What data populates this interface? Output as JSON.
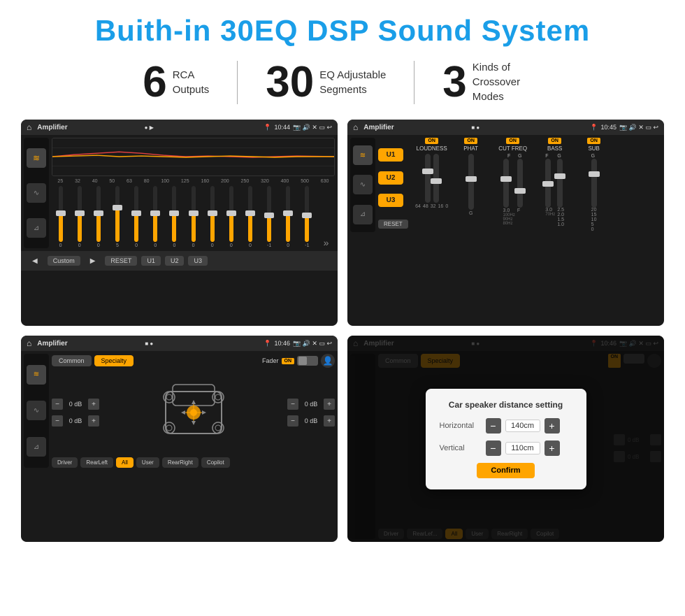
{
  "title": "Buith-in 30EQ DSP Sound System",
  "features": [
    {
      "number": "6",
      "line1": "RCA",
      "line2": "Outputs"
    },
    {
      "number": "30",
      "line1": "EQ Adjustable",
      "line2": "Segments"
    },
    {
      "number": "3",
      "line1": "Kinds of",
      "line2": "Crossover Modes"
    }
  ],
  "screens": {
    "eq": {
      "app_name": "Amplifier",
      "time": "10:44",
      "chart_labels": [
        "25",
        "32",
        "40",
        "50",
        "63",
        "80",
        "100",
        "125",
        "160",
        "200",
        "250",
        "320",
        "400",
        "500",
        "630"
      ],
      "slider_values": [
        "0",
        "0",
        "0",
        "5",
        "0",
        "0",
        "0",
        "0",
        "0",
        "0",
        "0",
        "-1",
        "0",
        "-1"
      ],
      "bottom_buttons": [
        "Custom",
        "RESET",
        "U1",
        "U2",
        "U3"
      ]
    },
    "crossover": {
      "app_name": "Amplifier",
      "time": "10:45",
      "presets": [
        "U1",
        "U2",
        "U3"
      ],
      "controls": [
        {
          "on": true,
          "label": "LOUDNESS",
          "value": ""
        },
        {
          "on": true,
          "label": "PHAT",
          "value": ""
        },
        {
          "on": true,
          "label": "CUT FREQ",
          "value": ""
        },
        {
          "on": true,
          "label": "BASS",
          "value": ""
        },
        {
          "on": true,
          "label": "SUB",
          "value": ""
        }
      ],
      "reset_label": "RESET"
    },
    "fader": {
      "app_name": "Amplifier",
      "time": "10:46",
      "tabs": [
        "Common",
        "Specialty"
      ],
      "fader_label": "Fader",
      "on_badge": "ON",
      "speaker_left_top": "0 dB",
      "speaker_left_bottom": "0 dB",
      "speaker_right_top": "0 dB",
      "speaker_right_bottom": "0 dB",
      "bottom_buttons": [
        "Driver",
        "RearLeft",
        "All",
        "User",
        "RearRight",
        "Copilot"
      ]
    },
    "distance": {
      "app_name": "Amplifier",
      "time": "10:46",
      "tabs": [
        "Common",
        "Specialty"
      ],
      "dialog": {
        "title": "Car speaker distance setting",
        "horizontal_label": "Horizontal",
        "horizontal_value": "140cm",
        "vertical_label": "Vertical",
        "vertical_value": "110cm",
        "confirm_label": "Confirm"
      },
      "speaker_right_top": "0 dB",
      "speaker_right_bottom": "0 dB",
      "bottom_buttons": [
        "Driver",
        "RearLeft",
        "All",
        "User",
        "RearRight",
        "Copilot"
      ]
    }
  },
  "icons": {
    "home": "⌂",
    "location": "📍",
    "speaker": "🔊",
    "back": "↩",
    "play": "▶",
    "pause": "⏸",
    "eq_icon": "≋",
    "wave_icon": "∿",
    "speaker_icon": "⊿",
    "settings_icon": "⚙",
    "person_icon": "👤"
  }
}
